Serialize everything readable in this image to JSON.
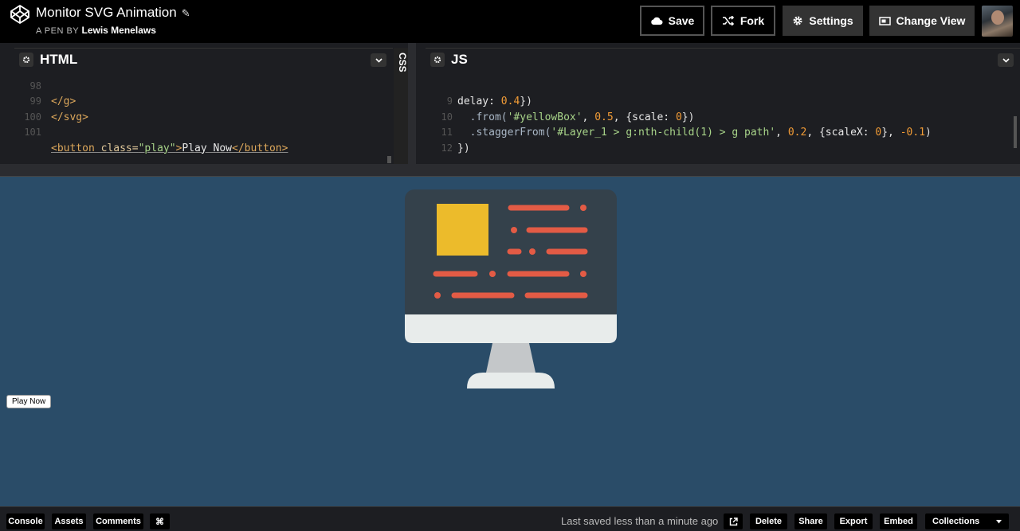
{
  "header": {
    "pen_title": "Monitor SVG Animation",
    "pen_by_prefix": "A PEN BY",
    "author": "Lewis Menelaws",
    "buttons": {
      "save": "Save",
      "fork": "Fork",
      "settings": "Settings",
      "change_view": "Change View"
    }
  },
  "editors": {
    "html": {
      "label": "HTML",
      "lines": [
        {
          "num": "98",
          "text": "</g>"
        },
        {
          "num": "99",
          "text": "</svg>"
        },
        {
          "num": "100",
          "text": ""
        },
        {
          "num": "101",
          "tag_open": "<button ",
          "attr": "class=",
          "str": "\"play\"",
          "close": ">",
          "content": "Play Now",
          "tag_close": "</button>"
        }
      ]
    },
    "css": {
      "label": "CSS"
    },
    "js": {
      "label": "JS",
      "lines": [
        {
          "num": "",
          "a": "delay: ",
          "b": "0.4",
          "c": "})"
        },
        {
          "num": "9",
          "a": "  .from(",
          "s": "'#yellowBox'",
          "b": ", ",
          "n1": "0.5",
          "d": ", {scale: ",
          "n2": "0",
          "e": "})"
        },
        {
          "num": "10",
          "a": "  .staggerFrom(",
          "s": "'#Layer_1 > g:nth-child(1) > g path'",
          "b": ", ",
          "n1": "0.2",
          "d": ", {scaleX: ",
          "n2": "0",
          "e": "}, ",
          "n3": "-0.1",
          "f": ")"
        },
        {
          "num": "11",
          "a": "})"
        },
        {
          "num": "12",
          "a": ""
        }
      ]
    }
  },
  "preview": {
    "play_button": "Play Now",
    "colors": {
      "background": "#2a4c68",
      "screen": "#34414b",
      "yellow_box": "#ecbb2b",
      "lines": "#e35b45",
      "bezel": "#e8eceb",
      "stand": "#c4c7c9"
    }
  },
  "footer": {
    "console": "Console",
    "assets": "Assets",
    "comments": "Comments",
    "shortcut": "⌘",
    "saved_status": "Last saved less than a minute ago",
    "delete": "Delete",
    "share": "Share",
    "export": "Export",
    "embed": "Embed",
    "collections": "Collections"
  }
}
